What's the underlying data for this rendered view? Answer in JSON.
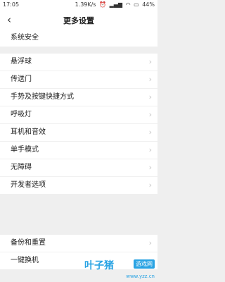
{
  "status_bar": {
    "time": "17:05",
    "speed": "1.39K/s",
    "icons": [
      "alarm-icon",
      "signal-icon",
      "wifi-icon",
      "battery-icon"
    ],
    "battery": "44%"
  },
  "header": {
    "back_icon": "‹",
    "title": "更多设置"
  },
  "settings": {
    "top": [
      {
        "label": "系统安全"
      }
    ],
    "group1": [
      {
        "label": "悬浮球"
      },
      {
        "label": "传送门"
      },
      {
        "label": "手势及按键快捷方式"
      },
      {
        "label": "呼吸灯"
      },
      {
        "label": "耳机和音效"
      },
      {
        "label": "单手模式"
      },
      {
        "label": "无障碍"
      },
      {
        "label": "开发者选项"
      }
    ],
    "group2": [
      {
        "label": "备份和重置"
      },
      {
        "label": "一键换机"
      }
    ]
  },
  "watermark": {
    "brand": "叶子猪",
    "sub": "游戏网",
    "url": "www.yzz.cn"
  },
  "colors": {
    "background": "#efefef",
    "card": "#ffffff",
    "chevron": "#c4c4c4",
    "watermark": "#29a3e3"
  }
}
